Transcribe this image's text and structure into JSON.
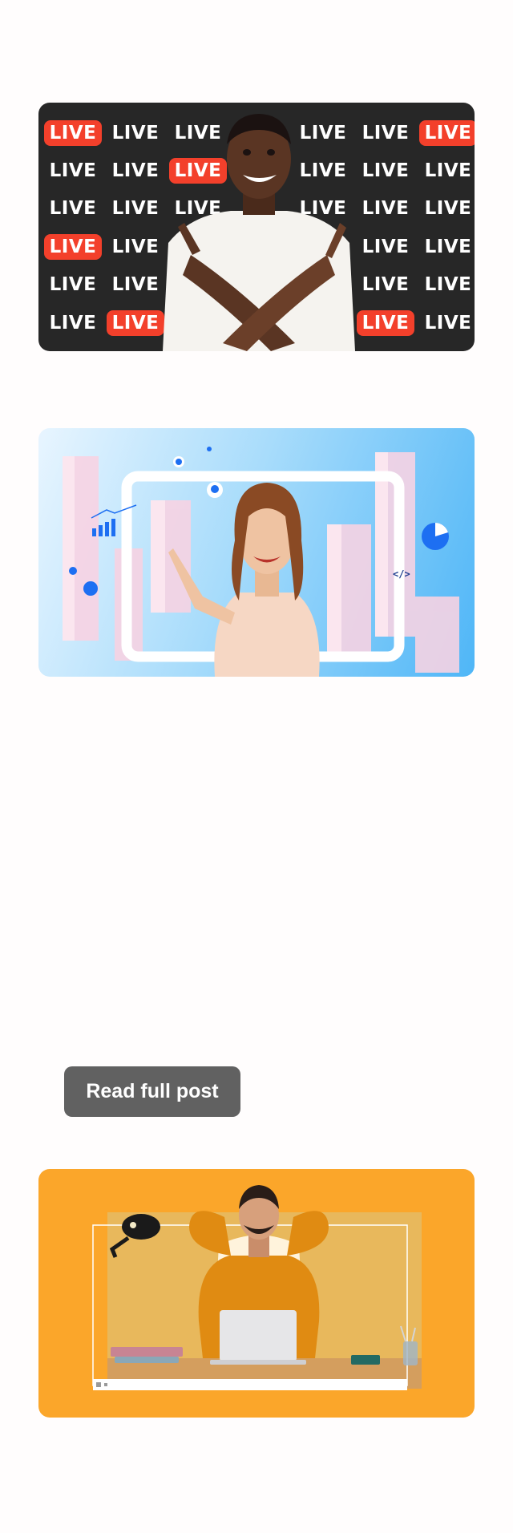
{
  "cards": {
    "live": {
      "grid": [
        [
          {
            "t": "LIVE",
            "hot": true
          },
          {
            "t": "LIVE",
            "hot": false
          },
          {
            "t": "LIVE",
            "hot": false
          },
          null,
          {
            "t": "LIVE",
            "hot": false
          },
          {
            "t": "LIVE",
            "hot": false
          },
          {
            "t": "LIVE",
            "hot": true
          }
        ],
        [
          {
            "t": "LIVE",
            "hot": false
          },
          {
            "t": "LIVE",
            "hot": false
          },
          {
            "t": "LIVE",
            "hot": true
          },
          null,
          {
            "t": "LIVE",
            "hot": false
          },
          {
            "t": "LIVE",
            "hot": false
          },
          {
            "t": "LIVE",
            "hot": false
          }
        ],
        [
          {
            "t": "LIVE",
            "hot": false
          },
          {
            "t": "LIVE",
            "hot": false
          },
          {
            "t": "LIVE",
            "hot": false
          },
          null,
          {
            "t": "LIVE",
            "hot": false
          },
          {
            "t": "LIVE",
            "hot": false
          },
          {
            "t": "LIVE",
            "hot": false
          }
        ],
        [
          {
            "t": "LIVE",
            "hot": true
          },
          {
            "t": "LIVE",
            "hot": false
          },
          null,
          null,
          null,
          {
            "t": "LIVE",
            "hot": false
          },
          {
            "t": "LIVE",
            "hot": false
          }
        ],
        [
          {
            "t": "LIVE",
            "hot": false
          },
          {
            "t": "LIVE",
            "hot": false
          },
          null,
          null,
          null,
          {
            "t": "LIVE",
            "hot": false
          },
          {
            "t": "LIVE",
            "hot": false
          }
        ],
        [
          {
            "t": "LIVE",
            "hot": false
          },
          {
            "t": "LIVE",
            "hot": true
          },
          null,
          null,
          null,
          {
            "t": "LIVE",
            "hot": true
          },
          {
            "t": "LIVE",
            "hot": false
          }
        ]
      ]
    },
    "analytics": {
      "code_label": "</>"
    }
  },
  "read_button": {
    "label": "Read full post"
  },
  "colors": {
    "live_red": "#f3402b",
    "live_bg": "#272727",
    "relax_bg": "#fba62a",
    "button_bg": "#616161"
  }
}
